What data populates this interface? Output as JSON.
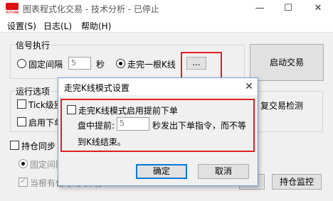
{
  "window": {
    "title": "图表程式化交易 - 技术分析 - 已停止",
    "logo_text": "OUYUAN",
    "minimize_glyph": "—",
    "maximize_glyph": "☐",
    "close_glyph": "✕"
  },
  "menu": {
    "items": [
      "设置(S)",
      "日志(L)",
      "帮助(H)"
    ]
  },
  "signal": {
    "group_label": "信号执行",
    "fixed_interval_label": "固定间隔",
    "interval_value": "5",
    "seconds_label": "秒",
    "bar_complete_label": "走完一根K线",
    "ellipsis_label": "...",
    "selected": "bar_complete"
  },
  "start_button_label": "启动交易",
  "run_options": {
    "group_label": "运行选项",
    "tick_label": "Tick级别",
    "enable_label": "启用下单",
    "dup_check_label": "复交易检测"
  },
  "position_sync": {
    "label": "持仓同步",
    "fixed_label": "固定间隔",
    "only_label": "当根有信号时才同步"
  },
  "bottom_buttons": {
    "left_label": "仓",
    "monitor_label": "持仓监控"
  },
  "dialog": {
    "title": "走完K线模式设置",
    "close_glyph": "✕",
    "checkbox_label": "走完K线模式启用提前下单",
    "advance_label": "盘中提前:",
    "advance_value": "5",
    "suffix_line1": "秒发出下单指令，而不等",
    "suffix_line2": "到K线结束。",
    "ok_label": "确定",
    "cancel_label": "取消"
  },
  "colors": {
    "highlight_red": "#e02020",
    "dialog_border": "#6e9fd4",
    "default_button_border": "#0078d7"
  }
}
